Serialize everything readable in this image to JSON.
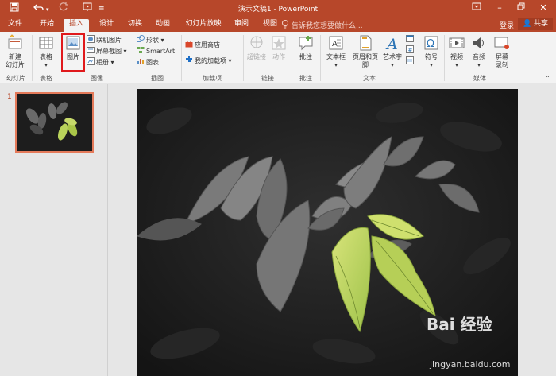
{
  "titlebar": {
    "title": "演示文稿1 - PowerPoint",
    "save_icon": "save-icon",
    "undo_icon": "undo-icon",
    "redo_icon": "redo-icon"
  },
  "tabs": [
    {
      "label": "文件"
    },
    {
      "label": "开始"
    },
    {
      "label": "插入"
    },
    {
      "label": "设计"
    },
    {
      "label": "切换"
    },
    {
      "label": "动画"
    },
    {
      "label": "幻灯片放映"
    },
    {
      "label": "审阅"
    },
    {
      "label": "视图"
    }
  ],
  "tellme": "告诉我您想要做什么...",
  "signin": "登录",
  "share": "共享",
  "ribbon": {
    "new_slide": "新建",
    "new_slide_2": "幻灯片",
    "table": "表格",
    "picture": "图片",
    "online_picture": "联机图片",
    "screenshot": "屏幕截图",
    "album": "相册",
    "shapes": "形状",
    "smartart": "SmartArt",
    "chart": "图表",
    "store": "应用商店",
    "my_addins": "我的加载项",
    "hyperlink": "超链接",
    "action": "动作",
    "comment": "批注",
    "textbox": "文本框",
    "header_footer": "页眉和页脚",
    "wordart": "艺术字",
    "symbol": "符号",
    "video": "视频",
    "audio": "音频",
    "screen_recording": "屏幕",
    "screen_recording_2": "录制"
  },
  "groups": {
    "slides": "幻灯片",
    "tables": "表格",
    "images": "图像",
    "illustrations": "插图",
    "addins": "加载项",
    "links": "链接",
    "comments": "批注",
    "text": "文本",
    "media": "媒体"
  },
  "thumbnail": {
    "number": "1"
  },
  "watermark": {
    "brand": "Bai 经验",
    "url": "jingyan.baidu.com"
  },
  "colors": {
    "accent": "#b7472a",
    "highlight": "#e0191c"
  }
}
